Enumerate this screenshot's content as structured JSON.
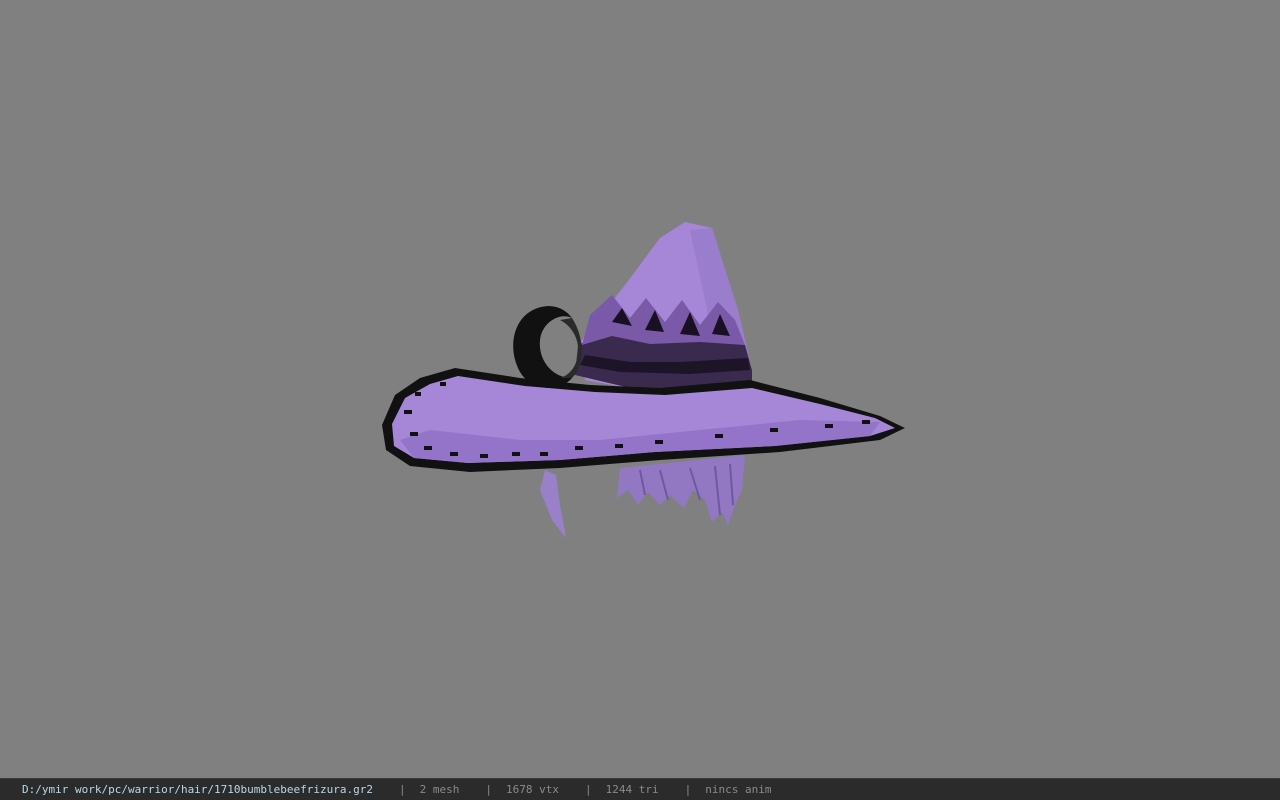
{
  "viewer": {
    "background_color": "#808080",
    "model_name": "witch-hat-with-hair",
    "model_colors": {
      "hat": "#a686d6",
      "hat_shadow": "#8a6cbc",
      "trim": "#111111",
      "hair": "#9a80c8"
    }
  },
  "status": {
    "file_path": "D:/ymir work/pc/warrior/hair/1710bumblebeefrizura.gr2",
    "separator": "|",
    "mesh_count": "2 mesh",
    "vertex_count": "1678 vtx",
    "triangle_count": "1244 tri",
    "anim": "nincs anim"
  }
}
